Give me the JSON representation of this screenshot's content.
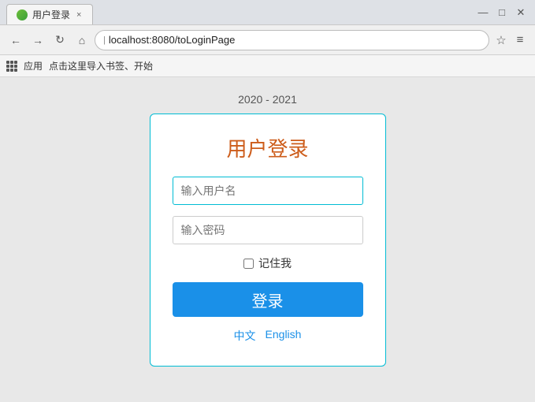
{
  "titlebar": {
    "tab_title": "用户登录",
    "tab_close": "×",
    "controls": {
      "minimize": "—",
      "maximize": "□",
      "close": "✕"
    }
  },
  "addressbar": {
    "back": "←",
    "forward": "→",
    "reload": "↻",
    "home": "⌂",
    "url": "localhost:8080/toLoginPage",
    "bookmark": "☆",
    "menu": "≡"
  },
  "bookmarks": {
    "apps_label": "应用",
    "link1": "点击这里导入书签、开始"
  },
  "page": {
    "year": "2020 - 2021",
    "login_title": "用户登录",
    "username_placeholder": "输入用户名",
    "password_placeholder": "输入密码",
    "remember_label": "记住我",
    "login_button": "登录",
    "lang_chinese": "中文",
    "lang_english": "English"
  }
}
